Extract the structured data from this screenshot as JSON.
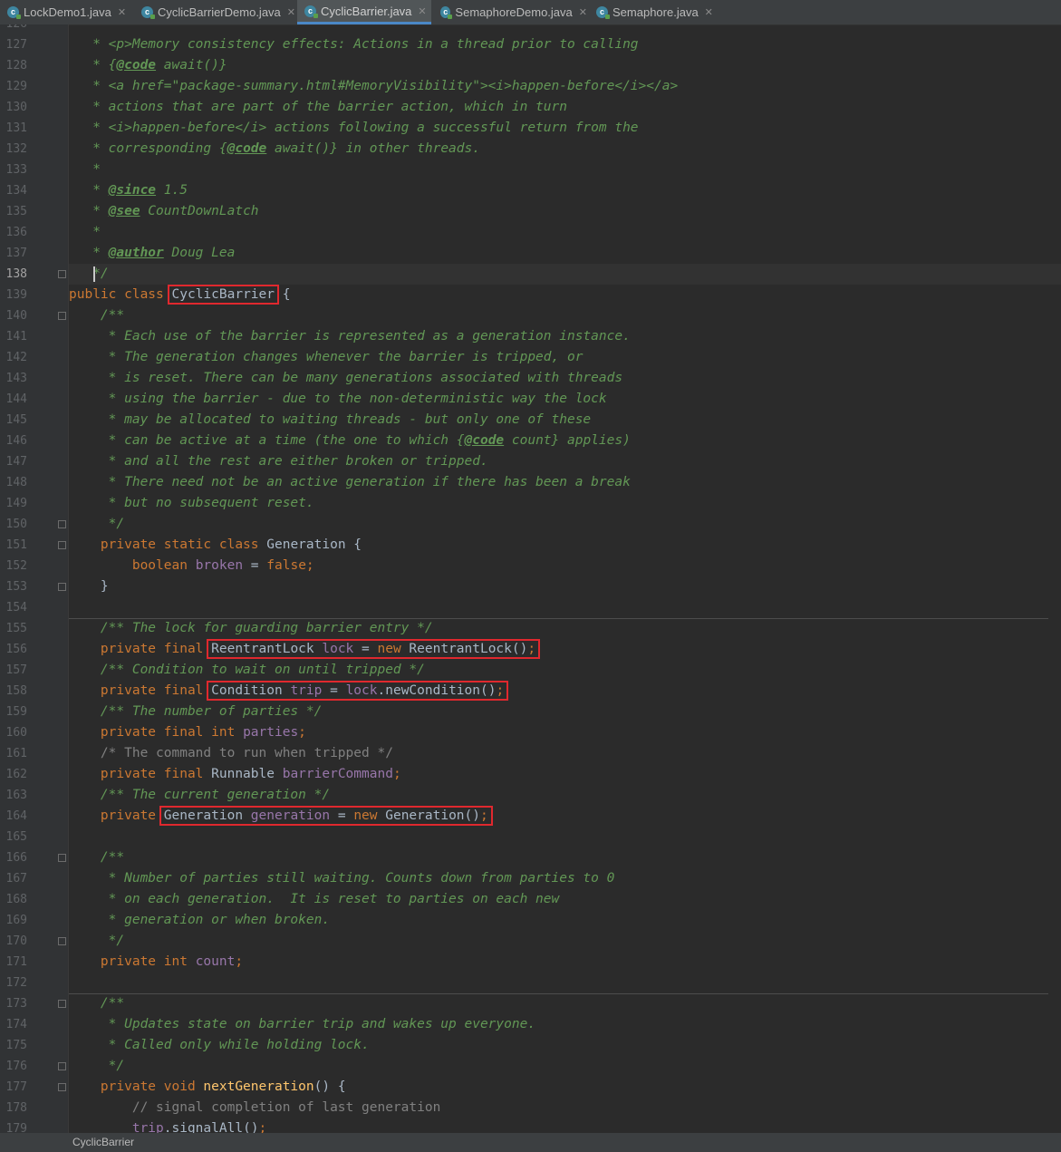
{
  "tabs": [
    {
      "label": "LockDemo1.java",
      "active": false
    },
    {
      "label": "CyclicBarrierDemo.java",
      "active": false
    },
    {
      "label": "CyclicBarrier.java",
      "active": true
    },
    {
      "label": "SemaphoreDemo.java",
      "active": false
    },
    {
      "label": "Semaphore.java",
      "active": false
    }
  ],
  "icons": {
    "file": "java-class-icon",
    "close": "close-icon",
    "fold": "fold-marker-icon"
  },
  "colors": {
    "keyword": "#cc7832",
    "doc_comment": "#629755",
    "field": "#9876aa",
    "method": "#ffc66d",
    "line_comment": "#808080",
    "highlight_box": "#e0282e"
  },
  "editor": {
    "current_line": "138",
    "lines": [
      {
        "n": "126",
        "segs": [
          {
            "t": "   *",
            "c": "c"
          }
        ]
      },
      {
        "n": "127",
        "segs": [
          {
            "t": "   * <p>Memory consistency effects: Actions in a thread prior to calling",
            "c": "c"
          }
        ]
      },
      {
        "n": "128",
        "segs": [
          {
            "t": "   * {",
            "c": "c"
          },
          {
            "t": "@code",
            "c": "tag"
          },
          {
            "t": " await()}",
            "c": "c"
          }
        ]
      },
      {
        "n": "129",
        "segs": [
          {
            "t": "   * <a href=\"package-summary.html#MemoryVisibility\"><i>happen-before</i></a>",
            "c": "c"
          }
        ]
      },
      {
        "n": "130",
        "segs": [
          {
            "t": "   * actions that are part of the barrier action, which in turn",
            "c": "c"
          }
        ]
      },
      {
        "n": "131",
        "segs": [
          {
            "t": "   * <i>happen-before</i> actions following a successful return from the",
            "c": "c"
          }
        ]
      },
      {
        "n": "132",
        "segs": [
          {
            "t": "   * corresponding {",
            "c": "c"
          },
          {
            "t": "@code",
            "c": "tag"
          },
          {
            "t": " await()} in other threads.",
            "c": "c"
          }
        ]
      },
      {
        "n": "133",
        "segs": [
          {
            "t": "   *",
            "c": "c"
          }
        ]
      },
      {
        "n": "134",
        "segs": [
          {
            "t": "   * ",
            "c": "c"
          },
          {
            "t": "@since",
            "c": "tag"
          },
          {
            "t": " 1.5",
            "c": "c"
          }
        ]
      },
      {
        "n": "135",
        "segs": [
          {
            "t": "   * ",
            "c": "c"
          },
          {
            "t": "@see",
            "c": "tag"
          },
          {
            "t": " CountDownLatch",
            "c": "c"
          }
        ]
      },
      {
        "n": "136",
        "segs": [
          {
            "t": "   *",
            "c": "c"
          }
        ]
      },
      {
        "n": "137",
        "segs": [
          {
            "t": "   * ",
            "c": "c"
          },
          {
            "t": "@author",
            "c": "tag"
          },
          {
            "t": " Doug Lea",
            "c": "c"
          }
        ]
      },
      {
        "n": "138",
        "segs": [
          {
            "t": "   */",
            "c": "c"
          }
        ]
      },
      {
        "n": "139",
        "segs": [
          {
            "t": "public class ",
            "c": "k"
          },
          {
            "t": "CyclicBarrier",
            "c": "",
            "box": true
          },
          {
            "t": " {",
            "c": ""
          }
        ]
      },
      {
        "n": "140",
        "segs": [
          {
            "t": "    /**",
            "c": "c"
          }
        ]
      },
      {
        "n": "141",
        "segs": [
          {
            "t": "     * Each use of the barrier is represented as a generation instance.",
            "c": "c"
          }
        ]
      },
      {
        "n": "142",
        "segs": [
          {
            "t": "     * The generation changes whenever the barrier is tripped, or",
            "c": "c"
          }
        ]
      },
      {
        "n": "143",
        "segs": [
          {
            "t": "     * is reset. There can be many generations associated with threads",
            "c": "c"
          }
        ]
      },
      {
        "n": "144",
        "segs": [
          {
            "t": "     * using the barrier - due to the non-deterministic way the lock",
            "c": "c"
          }
        ]
      },
      {
        "n": "145",
        "segs": [
          {
            "t": "     * may be allocated to waiting threads - but only one of these",
            "c": "c"
          }
        ]
      },
      {
        "n": "146",
        "segs": [
          {
            "t": "     * can be active at a time (the one to which {",
            "c": "c"
          },
          {
            "t": "@code",
            "c": "tag"
          },
          {
            "t": " count} applies)",
            "c": "c"
          }
        ]
      },
      {
        "n": "147",
        "segs": [
          {
            "t": "     * and all the rest are either broken or tripped.",
            "c": "c"
          }
        ]
      },
      {
        "n": "148",
        "segs": [
          {
            "t": "     * There need not be an active generation if there has been a break",
            "c": "c"
          }
        ]
      },
      {
        "n": "149",
        "segs": [
          {
            "t": "     * but no subsequent reset.",
            "c": "c"
          }
        ]
      },
      {
        "n": "150",
        "segs": [
          {
            "t": "     */",
            "c": "c"
          }
        ]
      },
      {
        "n": "151",
        "segs": [
          {
            "t": "    private static class ",
            "c": "k"
          },
          {
            "t": "Generation {",
            "c": ""
          }
        ]
      },
      {
        "n": "152",
        "segs": [
          {
            "t": "        ",
            "c": ""
          },
          {
            "t": "boolean ",
            "c": "k"
          },
          {
            "t": "broken",
            "c": "f"
          },
          {
            "t": " = ",
            "c": ""
          },
          {
            "t": "false;",
            "c": "k"
          }
        ]
      },
      {
        "n": "153",
        "segs": [
          {
            "t": "    }",
            "c": ""
          }
        ]
      },
      {
        "n": "154",
        "segs": []
      },
      {
        "n": "155",
        "segs": [
          {
            "t": "    /** The lock for guarding barrier entry */",
            "c": "c"
          }
        ]
      },
      {
        "n": "156",
        "segs": [
          {
            "t": "    private final ",
            "c": "k"
          },
          {
            "t": "",
            "c": "",
            "boxstart": true
          },
          {
            "t": "ReentrantLock ",
            "c": "",
            "inbox": true
          },
          {
            "t": "lock",
            "c": "f",
            "inbox": true
          },
          {
            "t": " = ",
            "c": "",
            "inbox": true
          },
          {
            "t": "new ",
            "c": "k",
            "inbox": true
          },
          {
            "t": "ReentrantLock()",
            "c": "",
            "inbox": true
          },
          {
            "t": ";",
            "c": "k",
            "inbox": true,
            "boxend": true
          }
        ]
      },
      {
        "n": "157",
        "segs": [
          {
            "t": "    /** Condition to wait on until tripped */",
            "c": "c"
          }
        ]
      },
      {
        "n": "158",
        "segs": [
          {
            "t": "    private final ",
            "c": "k"
          },
          {
            "t": "Condition ",
            "c": "",
            "inbox": true
          },
          {
            "t": "trip",
            "c": "f",
            "inbox": true
          },
          {
            "t": " = ",
            "c": "",
            "inbox": true
          },
          {
            "t": "lock",
            "c": "f",
            "inbox": true
          },
          {
            "t": ".newCondition()",
            "c": "",
            "inbox": true
          },
          {
            "t": ";",
            "c": "k",
            "inbox": true,
            "boxend": true
          }
        ]
      },
      {
        "n": "159",
        "segs": [
          {
            "t": "    /** The number of parties */",
            "c": "c"
          }
        ]
      },
      {
        "n": "160",
        "segs": [
          {
            "t": "    private final int ",
            "c": "k"
          },
          {
            "t": "parties",
            "c": "f"
          },
          {
            "t": ";",
            "c": "k"
          }
        ]
      },
      {
        "n": "161",
        "segs": [
          {
            "t": "    /* The command to run when tripped */",
            "c": "lc"
          }
        ]
      },
      {
        "n": "162",
        "segs": [
          {
            "t": "    private final ",
            "c": "k"
          },
          {
            "t": "Runnable ",
            "c": ""
          },
          {
            "t": "barrierCommand",
            "c": "f"
          },
          {
            "t": ";",
            "c": "k"
          }
        ]
      },
      {
        "n": "163",
        "segs": [
          {
            "t": "    /** The current generation */",
            "c": "c"
          }
        ]
      },
      {
        "n": "164",
        "segs": [
          {
            "t": "    private ",
            "c": "k"
          },
          {
            "t": "Generation ",
            "c": "",
            "inbox": true
          },
          {
            "t": "generation",
            "c": "f",
            "inbox": true
          },
          {
            "t": " = ",
            "c": "",
            "inbox": true
          },
          {
            "t": "new ",
            "c": "k",
            "inbox": true
          },
          {
            "t": "Generation()",
            "c": "",
            "inbox": true
          },
          {
            "t": ";",
            "c": "k",
            "inbox": true,
            "boxend": true
          }
        ]
      },
      {
        "n": "165",
        "segs": []
      },
      {
        "n": "166",
        "segs": [
          {
            "t": "    /**",
            "c": "c"
          }
        ]
      },
      {
        "n": "167",
        "segs": [
          {
            "t": "     * Number of parties still waiting. Counts down from parties to 0",
            "c": "c"
          }
        ]
      },
      {
        "n": "168",
        "segs": [
          {
            "t": "     * on each generation.  It is reset to parties on each new",
            "c": "c"
          }
        ]
      },
      {
        "n": "169",
        "segs": [
          {
            "t": "     * generation or when broken.",
            "c": "c"
          }
        ]
      },
      {
        "n": "170",
        "segs": [
          {
            "t": "     */",
            "c": "c"
          }
        ]
      },
      {
        "n": "171",
        "segs": [
          {
            "t": "    private int ",
            "c": "k"
          },
          {
            "t": "count",
            "c": "f"
          },
          {
            "t": ";",
            "c": "k"
          }
        ]
      },
      {
        "n": "172",
        "segs": []
      },
      {
        "n": "173",
        "segs": [
          {
            "t": "    /**",
            "c": "c"
          }
        ]
      },
      {
        "n": "174",
        "segs": [
          {
            "t": "     * Updates state on barrier trip and wakes up everyone.",
            "c": "c"
          }
        ]
      },
      {
        "n": "175",
        "segs": [
          {
            "t": "     * Called only while holding lock.",
            "c": "c"
          }
        ]
      },
      {
        "n": "176",
        "segs": [
          {
            "t": "     */",
            "c": "c"
          }
        ]
      },
      {
        "n": "177",
        "segs": [
          {
            "t": "    private void ",
            "c": "k"
          },
          {
            "t": "nextGeneration",
            "c": "m"
          },
          {
            "t": "() {",
            "c": ""
          }
        ]
      },
      {
        "n": "178",
        "segs": [
          {
            "t": "        // signal completion of last generation",
            "c": "lc"
          }
        ]
      },
      {
        "n": "179",
        "segs": [
          {
            "t": "        ",
            "c": ""
          },
          {
            "t": "trip",
            "c": "f"
          },
          {
            "t": ".signalAll()",
            "c": ""
          },
          {
            "t": ";",
            "c": "k"
          }
        ]
      }
    ]
  },
  "status_bar": {
    "breadcrumb": "CyclicBarrier"
  }
}
